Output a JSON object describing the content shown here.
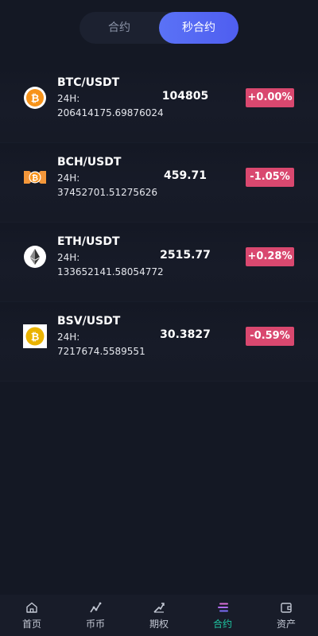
{
  "tabs": [
    {
      "label": "合约",
      "active": false
    },
    {
      "label": "秒合约",
      "active": true
    }
  ],
  "markets": [
    {
      "icon": "bitcoin-icon",
      "pair": "BTC/USDT",
      "volume_label": "24H:",
      "volume": "206414175.69876024",
      "price": "104805",
      "change": "+0.00%"
    },
    {
      "icon": "bitcoin-cash-icon",
      "pair": "BCH/USDT",
      "volume_label": "24H:",
      "volume": "37452701.51275626",
      "price": "459.71",
      "change": "-1.05%"
    },
    {
      "icon": "ethereum-icon",
      "pair": "ETH/USDT",
      "volume_label": "24H:",
      "volume": "133652141.58054772",
      "price": "2515.77",
      "change": "+0.28%"
    },
    {
      "icon": "bitcoin-sv-icon",
      "pair": "BSV/USDT",
      "volume_label": "24H:",
      "volume": "7217674.5589551",
      "price": "30.3827",
      "change": "-0.59%"
    }
  ],
  "nav": [
    {
      "label": "首页",
      "icon": "home-icon",
      "active": false
    },
    {
      "label": "币币",
      "icon": "trend-chart-icon",
      "active": false
    },
    {
      "label": "期权",
      "icon": "option-chart-icon",
      "active": false
    },
    {
      "label": "合约",
      "icon": "contract-lines-icon",
      "active": true
    },
    {
      "label": "资产",
      "icon": "wallet-icon",
      "active": false
    }
  ],
  "colors": {
    "background": "#141824",
    "accent": "#5a72f6",
    "badge": "#d9486f",
    "nav_active": "#1fc7a3"
  }
}
